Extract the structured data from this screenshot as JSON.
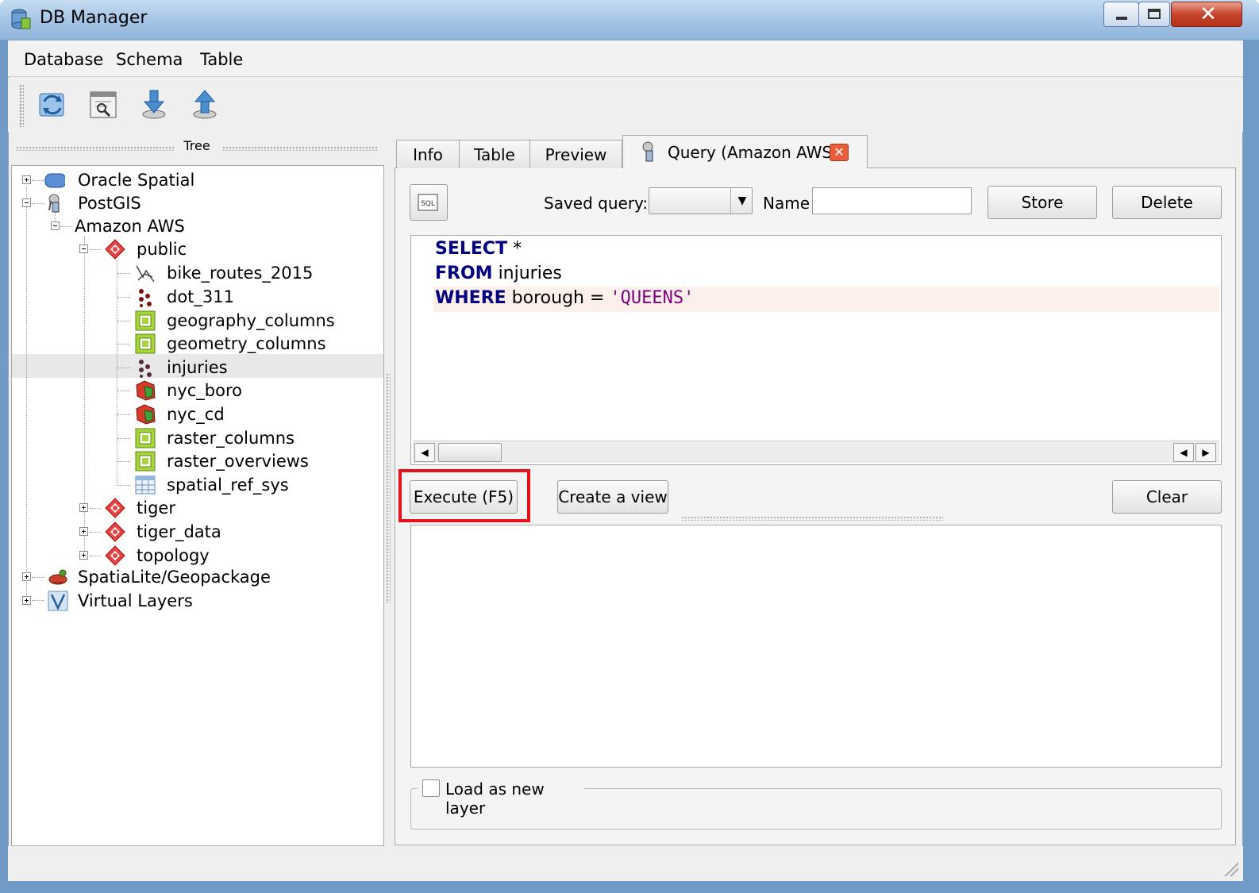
{
  "window": {
    "title": "DB Manager"
  },
  "menubar": {
    "items": [
      "Database",
      "Schema",
      "Table"
    ]
  },
  "toolbar": {
    "buttons": [
      "refresh-icon",
      "sql-window-icon",
      "import-layer-icon",
      "export-icon"
    ]
  },
  "tree": {
    "title": "Tree",
    "nodes": {
      "oracle": "Oracle Spatial",
      "postgis": "PostGIS",
      "amazon": "Amazon AWS",
      "public": "public",
      "bike_routes_2015": "bike_routes_2015",
      "dot_311": "dot_311",
      "geography_columns": "geography_columns",
      "geometry_columns": "geometry_columns",
      "injuries": "injuries",
      "nyc_boro": "nyc_boro",
      "nyc_cd": "nyc_cd",
      "raster_columns": "raster_columns",
      "raster_overviews": "raster_overviews",
      "spatial_ref_sys": "spatial_ref_sys",
      "tiger": "tiger",
      "tiger_data": "tiger_data",
      "topology": "topology",
      "spatialite": "SpatiaLite/Geopackage",
      "virtual": "Virtual Layers"
    },
    "selected": "injuries"
  },
  "tabs": {
    "info": "Info",
    "table": "Table",
    "preview": "Preview",
    "query": "Query (Amazon AWS)"
  },
  "query": {
    "saved_query_label": "Saved query:",
    "saved_query_value": "",
    "name_label": "Name",
    "name_value": "",
    "store": "Store",
    "delete": "Delete",
    "sql": {
      "kw_select": "SELECT",
      "select_rest": " *",
      "kw_from": "FROM",
      "from_rest": " injuries",
      "kw_where": "WHERE",
      "where_rest": " borough = ",
      "where_string": "'QUEENS'"
    },
    "execute": "Execute (F5)",
    "create_view": "Create a view",
    "clear": "Clear",
    "load_as_new_layer": "Load as new layer",
    "load_as_new_layer_checked": false
  },
  "colors": {
    "highlight_box": "#e8101a",
    "keyword": "#000080",
    "string": "#7f007f"
  }
}
